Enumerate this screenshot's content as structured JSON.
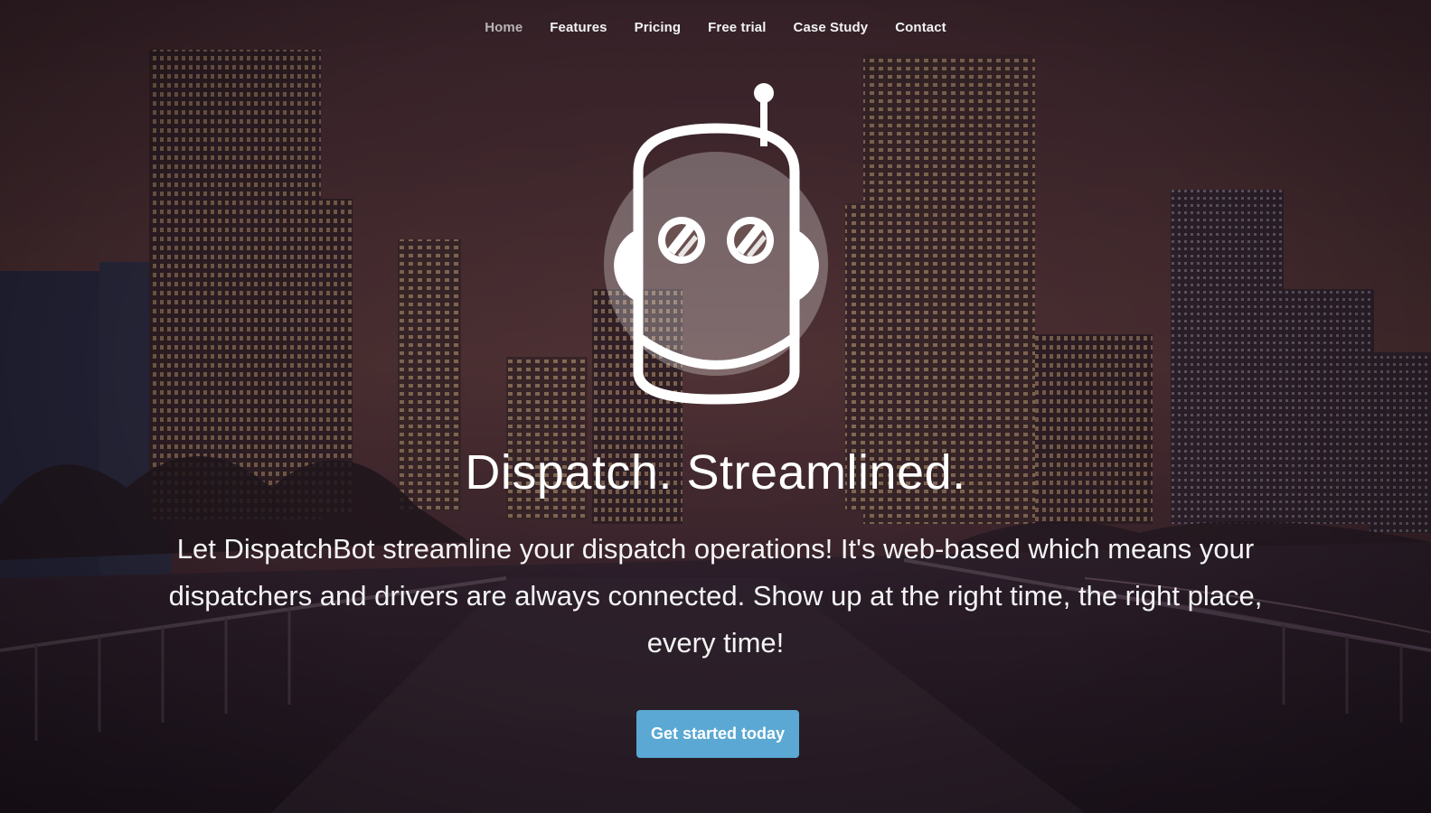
{
  "nav": {
    "items": [
      {
        "label": "Home",
        "active": true
      },
      {
        "label": "Features"
      },
      {
        "label": "Pricing"
      },
      {
        "label": "Free trial"
      },
      {
        "label": "Case Study"
      },
      {
        "label": "Contact"
      }
    ]
  },
  "hero": {
    "logo_icon": "robot-head-icon",
    "headline": "Dispatch. Streamlined.",
    "tagline": "Let DispatchBot streamline your dispatch operations! It's web-based which means your dispatchers and drivers are always connected. Show up at the right time, the right place, every time!",
    "cta_label": "Get started today"
  },
  "colors": {
    "accent": "#5aa8d3",
    "nav_active": "#b9b3b6",
    "text": "#ffffff"
  }
}
